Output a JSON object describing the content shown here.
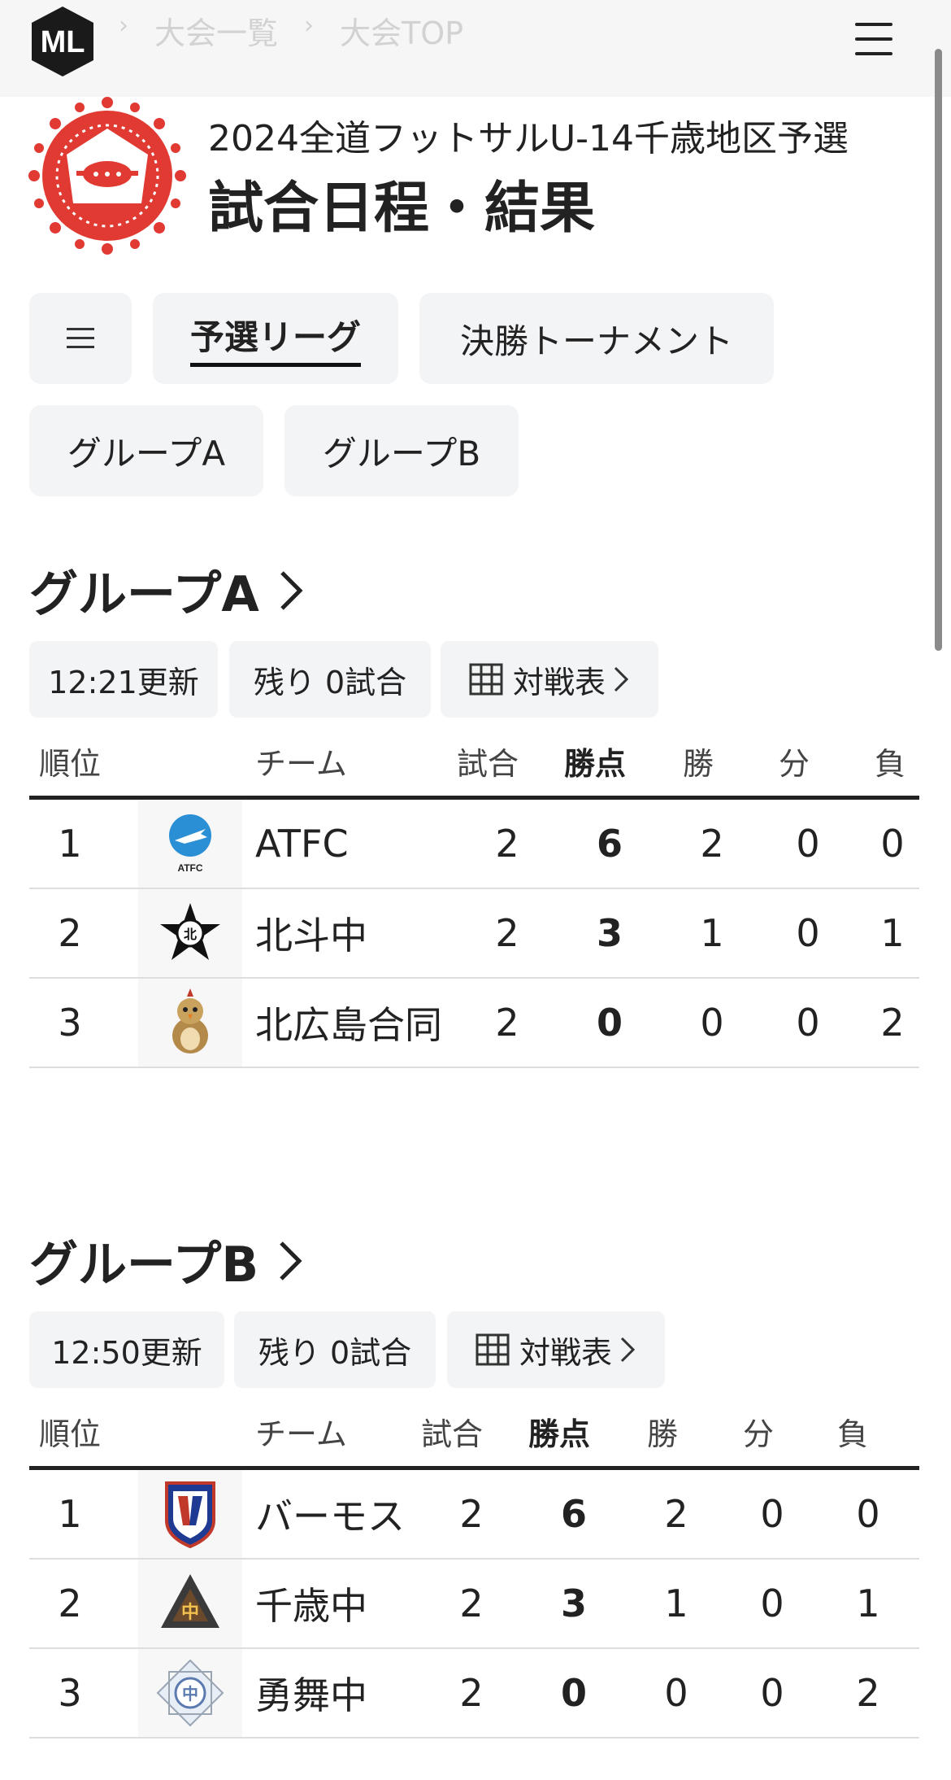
{
  "header": {
    "logo_text": "ML",
    "breadcrumbs": [
      "大会一覧",
      "大会TOP"
    ],
    "menu_icon": "hamburger-icon"
  },
  "tournament": {
    "name": "2024全道フットサルU-14千歳地区予選",
    "page_title": "試合日程・結果",
    "emblem_icon": "tournament-emblem"
  },
  "tabs": {
    "menu_icon": "list-icon",
    "items": [
      {
        "label": "予選リーグ",
        "active": true
      },
      {
        "label": "決勝トーナメント",
        "active": false
      }
    ],
    "groups": [
      "グループA",
      "グループB"
    ]
  },
  "columns": {
    "rank": "順位",
    "team": "チーム",
    "played": "試合",
    "points": "勝点",
    "won": "勝",
    "draw": "分",
    "lost": "負"
  },
  "groups": [
    {
      "title": "グループA",
      "updated": "12:21更新",
      "remaining": "残り 0試合",
      "matrix_label": "対戦表",
      "rows": [
        {
          "rank": "1",
          "team": "ATFC",
          "logo": "atfc-logo",
          "played": "2",
          "points": "6",
          "won": "2",
          "draw": "0",
          "lost": "0"
        },
        {
          "rank": "2",
          "team": "北斗中",
          "logo": "hokuto-logo",
          "played": "2",
          "points": "3",
          "won": "1",
          "draw": "0",
          "lost": "1"
        },
        {
          "rank": "3",
          "team": "北広島合同",
          "logo": "kitahiroshima-logo",
          "played": "2",
          "points": "0",
          "won": "0",
          "draw": "0",
          "lost": "2"
        }
      ]
    },
    {
      "title": "グループB",
      "updated": "12:50更新",
      "remaining": "残り 0試合",
      "matrix_label": "対戦表",
      "rows": [
        {
          "rank": "1",
          "team": "バーモス",
          "logo": "vamos-logo",
          "played": "2",
          "points": "6",
          "won": "2",
          "draw": "0",
          "lost": "0"
        },
        {
          "rank": "2",
          "team": "千歳中",
          "logo": "chitose-logo",
          "played": "2",
          "points": "3",
          "won": "1",
          "draw": "0",
          "lost": "1"
        },
        {
          "rank": "3",
          "team": "勇舞中",
          "logo": "yumai-logo",
          "played": "2",
          "points": "0",
          "won": "0",
          "draw": "0",
          "lost": "2"
        }
      ]
    }
  ]
}
